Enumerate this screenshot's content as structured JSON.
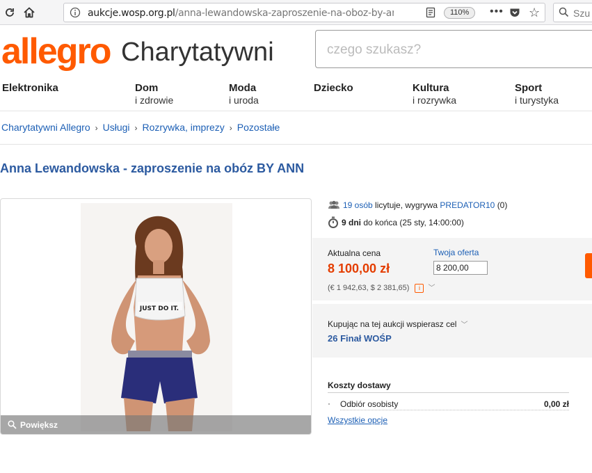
{
  "browser": {
    "url_host": "aukcje.wosp.org.pl",
    "url_path": "/anna-lewandowska-zaproszenie-na-oboz-by-ann",
    "zoom": "110%",
    "search_placeholder": "Szu"
  },
  "site": {
    "logo": "allegro",
    "logo_sub": "Charytatywni",
    "search_placeholder": "czego szukasz?"
  },
  "categories": [
    {
      "l1": "Elektronika",
      "l2": ""
    },
    {
      "l1": "Dom",
      "l2": "i zdrowie"
    },
    {
      "l1": "Moda",
      "l2": "i uroda"
    },
    {
      "l1": "Dziecko",
      "l2": ""
    },
    {
      "l1": "Kultura",
      "l2": "i rozrywka"
    },
    {
      "l1": "Sport",
      "l2": "i turystyka"
    }
  ],
  "breadcrumbs": [
    "Charytatywni Allegro",
    "Usługi",
    "Rozrywka, imprezy",
    "Pozostałe"
  ],
  "auction": {
    "title": "Anna Lewandowska - zaproszenie na obóz BY ANN",
    "zoom_label": "Powiększ",
    "shirt_text": "JUST DO IT.",
    "bidders_count": "19 osób",
    "bidders_text": "licytuje, wygrywa",
    "winner": "PREDATOR10",
    "winner_score": "(0)",
    "days_left": "9 dni",
    "time_text": "do końca (25 sty, 14:00:00)",
    "current_price_label": "Aktualna cena",
    "current_price": "8 100,00 zł",
    "price_conversion": "(€ 1 942,63, $ 2 381,65)",
    "offer_label": "Twoja oferta",
    "offer_value": "8 200,00",
    "cause_label": "Kupując na tej aukcji wspierasz cel",
    "cause_value": "26 Finał WOŚP",
    "shipping_title": "Koszty dostawy",
    "shipping_option": "Odbiór osobisty",
    "shipping_cost": "0,00 zł",
    "shipping_all": "Wszystkie opcje"
  },
  "colors": {
    "brand": "#ff5a00",
    "link": "#1c5fb5",
    "title": "#2c5aa0",
    "price": "#e43d00"
  }
}
